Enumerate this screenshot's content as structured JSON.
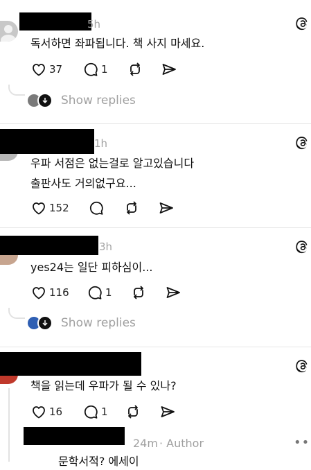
{
  "comments": [
    {
      "time": "5h",
      "text_lines": [
        "독서하면 좌파됩니다. 책 사지 마세요."
      ],
      "likes": "37",
      "replies": "1",
      "show_replies": "Show replies"
    },
    {
      "time": "1h",
      "text_lines": [
        "우파 서점은 없는걸로 알고있습니다",
        "출판사도 거의없구요..."
      ],
      "likes": "152",
      "replies": ""
    },
    {
      "time": "3h",
      "text_lines": [
        "yes24는 일단 피하심이..."
      ],
      "likes": "116",
      "replies": "1",
      "show_replies": "Show replies"
    },
    {
      "time": "",
      "text_lines": [
        "책을 읽는데 우파가 될 수 있나?"
      ],
      "likes": "16",
      "replies": "1"
    },
    {
      "time": "24m",
      "author_tag": "· Author",
      "more": "•••",
      "text_lines": [
        "문학서적? 에세이"
      ]
    }
  ],
  "icons": {
    "heart": "heart-icon",
    "reply": "comment-bubble-icon",
    "repost": "repost-icon",
    "share": "send-icon",
    "app": "threads-logo-icon"
  },
  "colors": {
    "text": "#111111",
    "muted": "#a0a0a0",
    "divider": "#e6e6e6"
  }
}
